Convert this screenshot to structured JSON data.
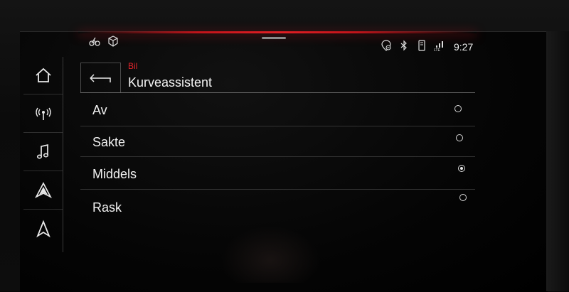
{
  "status_bar": {
    "left_icons": [
      "cyclist-icon",
      "package-icon"
    ],
    "right_icons": [
      "location-privacy-icon",
      "bluetooth-icon",
      "phone-icon",
      "lte-signal-icon"
    ],
    "time": "9:27"
  },
  "sidebar": {
    "items": [
      {
        "icon": "home-icon"
      },
      {
        "icon": "radio-icon"
      },
      {
        "icon": "music-icon"
      },
      {
        "icon": "android-auto-icon"
      },
      {
        "icon": "navigation-icon"
      }
    ]
  },
  "header": {
    "breadcrumb": "Bil",
    "title": "Kurveassistent"
  },
  "options": [
    {
      "label": "Av",
      "selected": false
    },
    {
      "label": "Sakte",
      "selected": false
    },
    {
      "label": "Middels",
      "selected": true
    },
    {
      "label": "Rask",
      "selected": false
    }
  ],
  "colors": {
    "accent": "#e0232a",
    "text": "#f2f2f2",
    "background": "#050505"
  }
}
